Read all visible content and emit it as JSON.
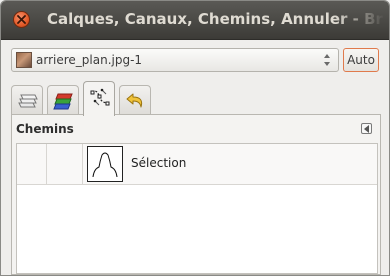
{
  "window": {
    "title": "Calques, Canaux, Chemins, Annuler - Br"
  },
  "image_selector": {
    "value": "arriere_plan.jpg-1",
    "auto_label": "Auto"
  },
  "tabs": [
    {
      "name": "layers",
      "icon": "layers-icon",
      "active": false
    },
    {
      "name": "channels",
      "icon": "channels-icon",
      "active": false
    },
    {
      "name": "paths",
      "icon": "paths-icon",
      "active": true
    },
    {
      "name": "undo",
      "icon": "undo-icon",
      "active": false
    }
  ],
  "panel": {
    "title": "Chemins",
    "rows": [
      {
        "label": "Sélection"
      }
    ]
  },
  "colors": {
    "titlebar": "#3c3b37",
    "close": "#e25a28",
    "accent": "#e07a4c"
  }
}
